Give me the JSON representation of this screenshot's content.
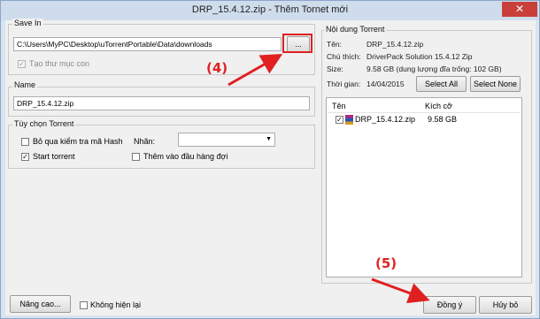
{
  "window": {
    "title": "DRP_15.4.12.zip - Thêm Tornet mới",
    "close_glyph": "✕"
  },
  "save_in": {
    "label": "Save In",
    "path": "C:\\Users\\MyPC\\Desktop\\uTorrentPortable\\Data\\downloads",
    "browse_label": "...",
    "create_subfolder_label": "Tạo thư mục con",
    "create_subfolder_checked": true
  },
  "name": {
    "label": "Name",
    "value": "DRP_15.4.12.zip"
  },
  "options": {
    "label": "Tùy chọn Torrent",
    "skip_hash_label": "Bỏ qua kiểm tra mã Hash",
    "skip_hash_checked": false,
    "start_torrent_label": "Start torrent",
    "start_torrent_checked": true,
    "tag_label": "Nhãn:",
    "tag_value": "",
    "add_top_queue_label": "Thêm vào đầu hàng đợi",
    "add_top_queue_checked": false
  },
  "content": {
    "label": "Nội dung Torrent",
    "name_key": "Tên:",
    "name_value": "DRP_15.4.12.zip",
    "comment_key": "Chú thích:",
    "comment_value": "DriverPack Solution 15.4.12 Zip",
    "size_key": "Size:",
    "size_value": "9.58 GB (dung lượng đĩa trống: 102 GB)",
    "time_key": "Thời gian:",
    "time_value": "14/04/2015",
    "select_all_label": "Select All",
    "select_none_label": "Select None",
    "columns": {
      "name": "Tên",
      "size": "Kích cỡ"
    },
    "files": [
      {
        "name": "DRP_15.4.12.zip",
        "size": "9.58 GB",
        "checked": true
      }
    ]
  },
  "footer": {
    "advanced_label": "Nâng cao...",
    "dont_show_label": "Không hiện lại",
    "dont_show_checked": false,
    "ok_label": "Đồng ý",
    "cancel_label": "Hủy bỏ"
  },
  "annotations": {
    "step4": "(4)",
    "step5": "(5)",
    "color": "#e02020"
  }
}
